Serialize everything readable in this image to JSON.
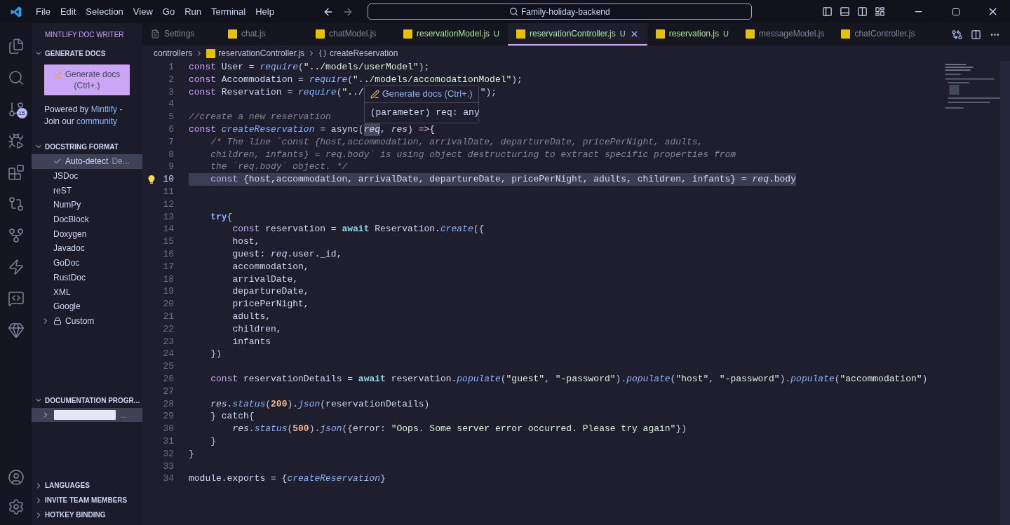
{
  "title_bar": {
    "menu": [
      "File",
      "Edit",
      "Selection",
      "View",
      "Go",
      "Run",
      "Terminal",
      "Help"
    ],
    "search": "Family-holiday-backend"
  },
  "activity_bar": {
    "scm_badge": "15"
  },
  "sidebar": {
    "title": "MINTLIFY DOC WRITER",
    "generate": {
      "title": "GENERATE DOCS",
      "expanded": true,
      "button": "Generate docs (Ctrl+.)",
      "credit": [
        {
          "kind": "text",
          "t": "Powered by "
        },
        {
          "kind": "link",
          "t": "Mintlify"
        },
        {
          "kind": "text",
          "t": " - Join our "
        },
        {
          "kind": "link",
          "t": "community"
        }
      ]
    },
    "formats": {
      "title": "DOCSTRING FORMAT",
      "expanded": true,
      "items": [
        {
          "kind": "format",
          "label": "Auto-detect",
          "detail": "De...",
          "selected": true,
          "checked": true
        },
        {
          "kind": "format",
          "label": "JSDoc",
          "selected": false,
          "checked": false
        },
        {
          "kind": "format",
          "label": "reST",
          "selected": false,
          "checked": false
        },
        {
          "kind": "format",
          "label": "NumPy",
          "selected": false,
          "checked": false
        },
        {
          "kind": "format",
          "label": "DocBlock",
          "selected": false,
          "checked": false
        },
        {
          "kind": "format",
          "label": "Doxygen",
          "selected": false,
          "checked": false
        },
        {
          "kind": "format",
          "label": "Javadoc",
          "selected": false,
          "checked": false
        },
        {
          "kind": "format",
          "label": "GoDoc",
          "selected": false,
          "checked": false
        },
        {
          "kind": "format",
          "label": "RustDoc",
          "selected": false,
          "checked": false
        },
        {
          "kind": "format",
          "label": "XML",
          "selected": false,
          "checked": false
        },
        {
          "kind": "format",
          "label": "Google",
          "selected": false,
          "checked": false
        },
        {
          "kind": "folder",
          "label": "Custom",
          "selected": false,
          "checked": false
        }
      ]
    },
    "progress": {
      "title": "DOCUMENTATION PROGR...",
      "expanded": true,
      "items": [
        {
          "tail": "...",
          "selected": true
        }
      ]
    },
    "footer": [
      {
        "title": "LANGUAGES",
        "expanded": false
      },
      {
        "title": "INVITE TEAM MEMBERS",
        "expanded": false
      },
      {
        "title": "HOTKEY BINDING",
        "expanded": false
      }
    ]
  },
  "tabs": [
    {
      "kind": "settings",
      "label": "Settings",
      "selected": false
    },
    {
      "kind": "js",
      "label": "chat.js",
      "selected": false
    },
    {
      "kind": "js",
      "label": "chatModel.js",
      "selected": false
    },
    {
      "kind": "js",
      "label": "reservationModel.js",
      "badge": "U",
      "selected": false
    },
    {
      "kind": "js",
      "label": "reservationController.js",
      "badge": "U",
      "selected": true
    },
    {
      "kind": "js",
      "label": "reservation.js",
      "badge": "U",
      "selected": false
    },
    {
      "kind": "js",
      "label": "messageModel.js",
      "selected": false
    },
    {
      "kind": "js",
      "label": "chatController.js",
      "selected": false
    }
  ],
  "breadcrumbs": [
    {
      "kind": "folder",
      "t": "controllers"
    },
    {
      "kind": "js",
      "t": "reservationController.js"
    },
    {
      "kind": "symbol",
      "t": "createReservation"
    }
  ],
  "hover": {
    "title": "Generate docs (Ctrl+.)",
    "body": "(parameter) req: any"
  },
  "code": [
    {
      "n": "1",
      "tokens": [
        {
          "kind": "keyword",
          "t": "const"
        },
        {
          "kind": "ident",
          "t": " User = "
        },
        {
          "kind": "func",
          "t": "require"
        },
        {
          "kind": "punct",
          "t": "("
        },
        {
          "kind": "string",
          "t": "\"../models/userModel\""
        },
        {
          "kind": "punct",
          "t": ");"
        }
      ]
    },
    {
      "n": "2",
      "tokens": [
        {
          "kind": "keyword",
          "t": "const"
        },
        {
          "kind": "ident",
          "t": " Accommodation = "
        },
        {
          "kind": "func",
          "t": "require"
        },
        {
          "kind": "punct",
          "t": "("
        },
        {
          "kind": "string",
          "t": "\"../models/accomodationModel\""
        },
        {
          "kind": "punct",
          "t": ");"
        }
      ]
    },
    {
      "n": "3",
      "tokens": [
        {
          "kind": "keyword",
          "t": "const"
        },
        {
          "kind": "ident",
          "t": " Reservation = "
        },
        {
          "kind": "func",
          "t": "require"
        },
        {
          "kind": "punct",
          "t": "("
        },
        {
          "kind": "string",
          "t": "\"../"
        },
        {
          "kind": "gap"
        },
        {
          "kind": "string",
          "t": "\""
        },
        {
          "kind": "punct",
          "t": ");"
        }
      ]
    },
    {
      "n": "4"
    },
    {
      "n": "5",
      "tokens": [
        {
          "kind": "comment",
          "t": "//create a new reservation"
        }
      ]
    },
    {
      "n": "6",
      "tokens": [
        {
          "kind": "keyword",
          "t": "const "
        },
        {
          "kind": "func",
          "t": "createReservation"
        },
        {
          "kind": "ident",
          "t": " = async("
        },
        {
          "kind": "match",
          "t": "req"
        },
        {
          "kind": "ident",
          "t": ", "
        },
        {
          "kind": "param",
          "t": "res"
        },
        {
          "kind": "operator",
          "t": ") =>{"
        }
      ]
    },
    {
      "n": "7",
      "tokens": [
        {
          "kind": "comment",
          "t": "    /* The line `const {host,accommodation, arrivalDate, departureDate, pricePerNight, adults,"
        }
      ]
    },
    {
      "n": "8",
      "tokens": [
        {
          "kind": "comment",
          "t": "    children, infants} = req.body` is using object destructuring to extract specific properties from"
        }
      ]
    },
    {
      "n": "9",
      "tokens": [
        {
          "kind": "comment",
          "t": "    the `req.body` object. */"
        }
      ]
    },
    {
      "n": "10",
      "selected": true,
      "lightbulb": true,
      "tokens": [
        {
          "kind": "keyword",
          "t": "    const"
        },
        {
          "kind": "ident",
          "t": " {host,accommodation, arrivalDate, departureDate, pricePerNight, adults, children, infants} = "
        },
        {
          "kind": "param",
          "t": "req"
        },
        {
          "kind": "ident",
          "t": ".body"
        }
      ]
    },
    {
      "n": "11"
    },
    {
      "n": "12"
    },
    {
      "n": "13",
      "tokens": [
        {
          "kind": "control",
          "t": "    try"
        },
        {
          "kind": "punct",
          "t": "{"
        }
      ]
    },
    {
      "n": "14",
      "tokens": [
        {
          "kind": "keyword",
          "t": "        const"
        },
        {
          "kind": "ident",
          "t": " reservation = "
        },
        {
          "kind": "await",
          "t": "await"
        },
        {
          "kind": "ident",
          "t": " Reservation."
        },
        {
          "kind": "func",
          "t": "create"
        },
        {
          "kind": "punct",
          "t": "({"
        }
      ]
    },
    {
      "n": "15",
      "tokens": [
        {
          "kind": "ident",
          "t": "        host,"
        }
      ]
    },
    {
      "n": "16",
      "tokens": [
        {
          "kind": "ident",
          "t": "        guest: "
        },
        {
          "kind": "param",
          "t": "req"
        },
        {
          "kind": "ident",
          "t": ".user._id,"
        }
      ]
    },
    {
      "n": "17",
      "tokens": [
        {
          "kind": "ident",
          "t": "        accommodation,"
        }
      ]
    },
    {
      "n": "18",
      "tokens": [
        {
          "kind": "ident",
          "t": "        arrivalDate,"
        }
      ]
    },
    {
      "n": "19",
      "tokens": [
        {
          "kind": "ident",
          "t": "        departureDate,"
        }
      ]
    },
    {
      "n": "20",
      "tokens": [
        {
          "kind": "ident",
          "t": "        pricePerNight,"
        }
      ]
    },
    {
      "n": "21",
      "tokens": [
        {
          "kind": "ident",
          "t": "        adults,"
        }
      ]
    },
    {
      "n": "22",
      "tokens": [
        {
          "kind": "ident",
          "t": "        children,"
        }
      ]
    },
    {
      "n": "23",
      "tokens": [
        {
          "kind": "ident",
          "t": "        infants"
        }
      ]
    },
    {
      "n": "24",
      "tokens": [
        {
          "kind": "punct",
          "t": "    })"
        }
      ]
    },
    {
      "n": "25"
    },
    {
      "n": "26",
      "tokens": [
        {
          "kind": "keyword",
          "t": "    const"
        },
        {
          "kind": "ident",
          "t": " reservationDetails = "
        },
        {
          "kind": "await",
          "t": "await"
        },
        {
          "kind": "ident",
          "t": " reservation."
        },
        {
          "kind": "func",
          "t": "populate"
        },
        {
          "kind": "punct",
          "t": "("
        },
        {
          "kind": "string",
          "t": "\"guest\""
        },
        {
          "kind": "punct",
          "t": ", "
        },
        {
          "kind": "string",
          "t": "\"-password\""
        },
        {
          "kind": "punct",
          "t": ")."
        },
        {
          "kind": "func",
          "t": "populate"
        },
        {
          "kind": "punct",
          "t": "("
        },
        {
          "kind": "string",
          "t": "\"host\""
        },
        {
          "kind": "punct",
          "t": ", "
        },
        {
          "kind": "string",
          "t": "\"-password\""
        },
        {
          "kind": "punct",
          "t": ")."
        },
        {
          "kind": "func",
          "t": "populate"
        },
        {
          "kind": "punct",
          "t": "("
        },
        {
          "kind": "string",
          "t": "\"accommodation\""
        },
        {
          "kind": "punct",
          "t": ")"
        }
      ]
    },
    {
      "n": "27"
    },
    {
      "n": "28",
      "tokens": [
        {
          "kind": "param",
          "t": "    res"
        },
        {
          "kind": "ident",
          "t": "."
        },
        {
          "kind": "func",
          "t": "status"
        },
        {
          "kind": "punct",
          "t": "("
        },
        {
          "kind": "number",
          "t": "200"
        },
        {
          "kind": "punct",
          "t": ")."
        },
        {
          "kind": "func",
          "t": "json"
        },
        {
          "kind": "punct",
          "t": "("
        },
        {
          "kind": "ident",
          "t": "reservationDetails"
        },
        {
          "kind": "punct",
          "t": ")"
        }
      ]
    },
    {
      "n": "29",
      "tokens": [
        {
          "kind": "punct",
          "t": "    } "
        },
        {
          "kind": "ident",
          "t": "catch"
        },
        {
          "kind": "punct",
          "t": "{"
        }
      ]
    },
    {
      "n": "30",
      "tokens": [
        {
          "kind": "param",
          "t": "        res"
        },
        {
          "kind": "ident",
          "t": "."
        },
        {
          "kind": "func",
          "t": "status"
        },
        {
          "kind": "punct",
          "t": "("
        },
        {
          "kind": "number",
          "t": "500"
        },
        {
          "kind": "punct",
          "t": ")."
        },
        {
          "kind": "func",
          "t": "json"
        },
        {
          "kind": "punct",
          "t": "({"
        },
        {
          "kind": "ident",
          "t": "error: "
        },
        {
          "kind": "string",
          "t": "\"Oops. Some server error occurred. Please try again\""
        },
        {
          "kind": "punct",
          "t": "})"
        }
      ]
    },
    {
      "n": "31",
      "tokens": [
        {
          "kind": "punct",
          "t": "    }"
        }
      ]
    },
    {
      "n": "32",
      "tokens": [
        {
          "kind": "punct",
          "t": "}"
        }
      ]
    },
    {
      "n": "33"
    },
    {
      "n": "34",
      "tokens": [
        {
          "kind": "ident",
          "t": "module.exports = {"
        },
        {
          "kind": "func",
          "t": "createReservation"
        },
        {
          "kind": "punct",
          "t": "}"
        }
      ]
    }
  ]
}
